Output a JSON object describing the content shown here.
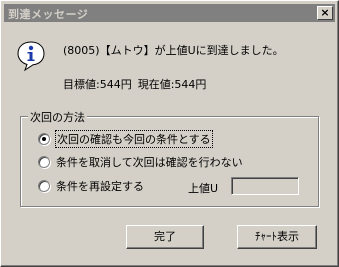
{
  "window": {
    "title": "到達メッセージ",
    "close_glyph": "×"
  },
  "message": {
    "line1": "(8005)【ムトウ】が上値Uに到達しました。",
    "target_label": "目標値:544円",
    "current_label": "現在値:544円"
  },
  "next_method": {
    "legend": "次回の方法",
    "options": [
      {
        "label": "次回の確認も今回の条件とする",
        "selected": true
      },
      {
        "label": "条件を取消して次回は確認を行わない",
        "selected": false
      },
      {
        "label": "条件を再設定する",
        "selected": false
      }
    ],
    "upper_limit_label": "上値U",
    "upper_limit_value": ""
  },
  "buttons": {
    "done": "完了",
    "chart": "ﾁｬｰﾄ表示"
  },
  "icons": {
    "info": "info-icon"
  }
}
